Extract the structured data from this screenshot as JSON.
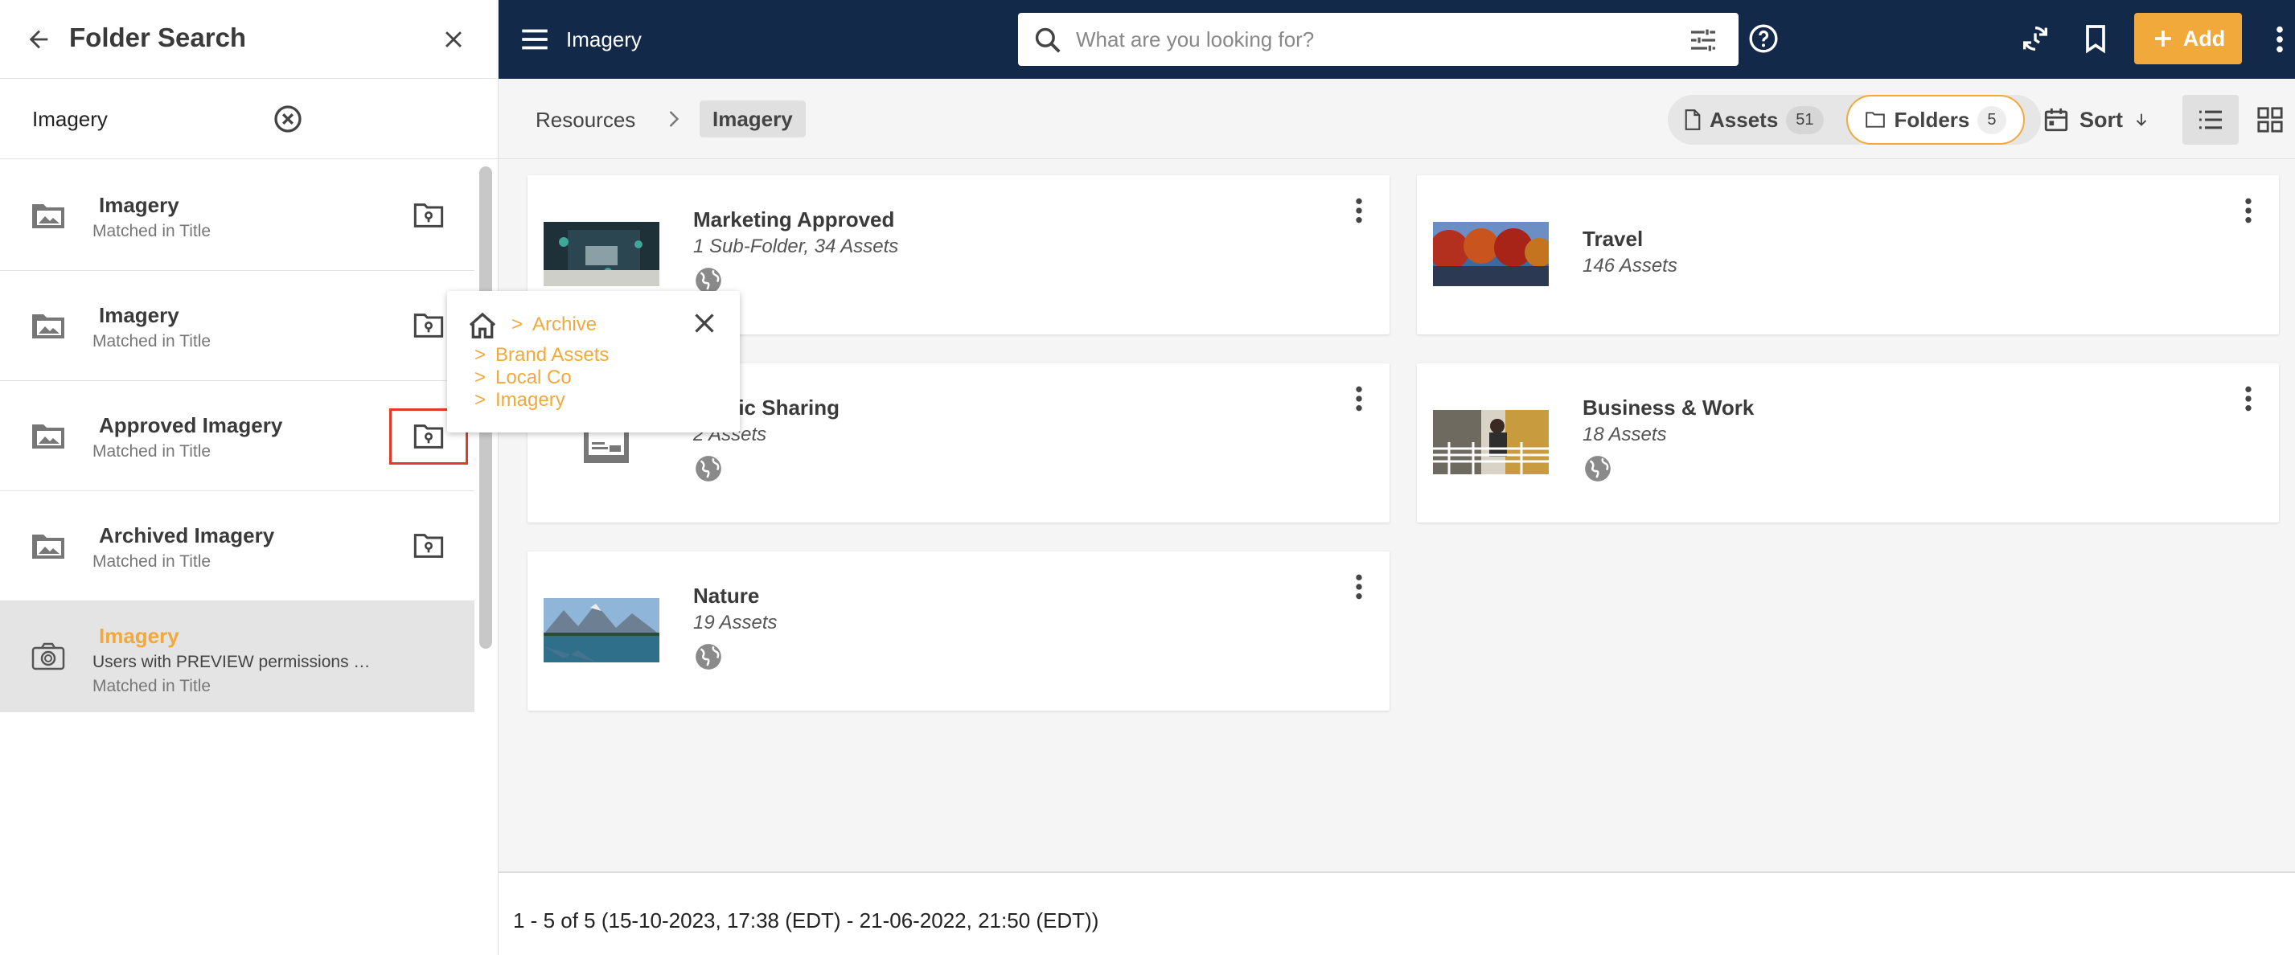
{
  "panel": {
    "title": "Folder Search",
    "search_value": "Imagery",
    "items": [
      {
        "title": "Imagery",
        "sub": "Matched in Title"
      },
      {
        "title": "Imagery",
        "sub": "Matched in Title"
      },
      {
        "title": "Approved Imagery",
        "sub": "Matched in Title"
      },
      {
        "title": "Archived Imagery",
        "sub": "Matched in Title"
      },
      {
        "title": "Imagery",
        "desc": "Users with PREVIEW permissions …",
        "sub": "Matched in Title"
      }
    ]
  },
  "topbar": {
    "title": "Imagery",
    "search_placeholder": "What are you looking for?",
    "add_label": "Add"
  },
  "breadcrumb": {
    "root": "Resources",
    "current": "Imagery"
  },
  "toolbar": {
    "assets_label": "Assets",
    "assets_count": "51",
    "folders_label": "Folders",
    "folders_count": "5",
    "sort_label": "Sort"
  },
  "cards": [
    {
      "title": "Marketing Approved",
      "sub": "1 Sub-Folder, 34 Assets"
    },
    {
      "title": "Travel",
      "sub": "146 Assets"
    },
    {
      "title": "Public Sharing",
      "sub": "2 Assets"
    },
    {
      "title": "Business & Work",
      "sub": "18 Assets"
    },
    {
      "title": "Nature",
      "sub": "19 Assets"
    }
  ],
  "popover": {
    "path": [
      "Archive",
      "Brand Assets",
      "Local Co",
      "Imagery"
    ],
    "separator": ">"
  },
  "footer": {
    "range": "1 - 5 of 5 (15-10-2023, 17:38 (EDT) - 21-06-2022, 21:50 (EDT))"
  },
  "colors": {
    "navy": "#12294a",
    "accent": "#f2a93b",
    "highlight_border": "#e03b2a"
  }
}
